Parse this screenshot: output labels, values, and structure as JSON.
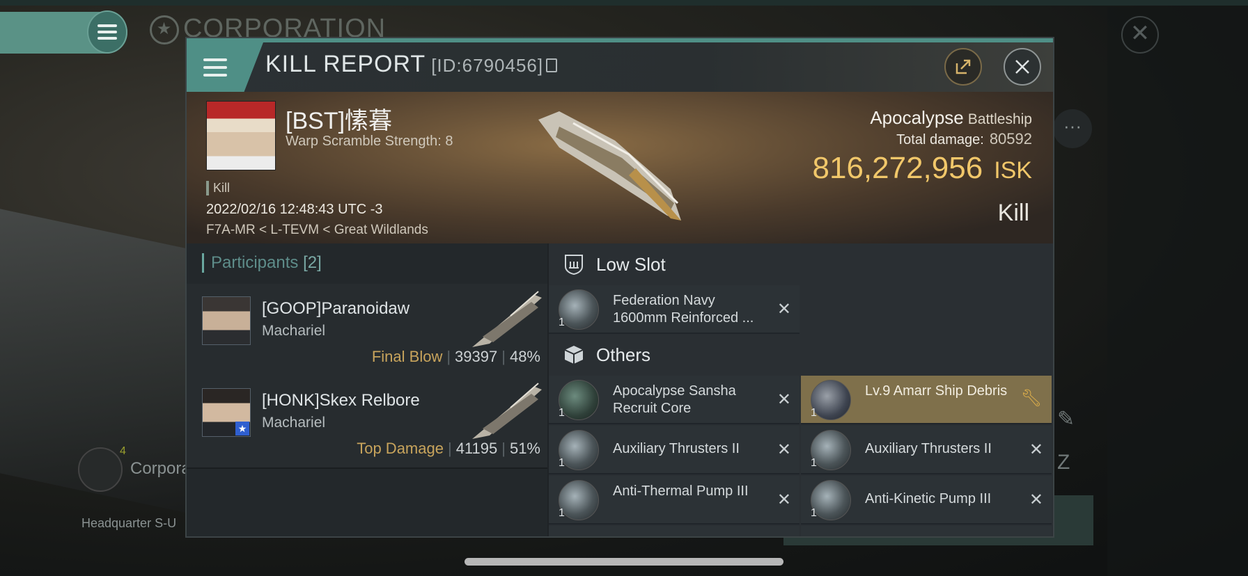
{
  "background": {
    "corp_title": "CORPORATION",
    "corp_label": "Corpora",
    "corp_number": "4",
    "headquarter": "Headquarter S-U"
  },
  "dialog": {
    "title": "KILL REPORT",
    "id": "[ID:6790456]"
  },
  "banner": {
    "pilot": "[BST]愫暮",
    "warp_scramble": "Warp Scramble Strength: 8",
    "kill_tag": "Kill",
    "datetime": "2022/02/16 12:48:43 UTC -3",
    "location": "F7A-MR < L-TEVM < Great Wildlands",
    "ship_name": "Apocalypse",
    "ship_class": "Battleship",
    "total_damage_label": "Total damage:",
    "total_damage": "80592",
    "isk_value": "816,272,956",
    "isk_unit": "ISK",
    "result": "Kill"
  },
  "participants": {
    "title": "Participants",
    "count": "[2]",
    "rows": [
      {
        "name": "[GOOP]Paranoidaw",
        "ship": "Machariel",
        "role": "Final Blow",
        "damage": "39397",
        "percent": "48%"
      },
      {
        "name": "[HONK]Skex Relbore",
        "ship": "Machariel",
        "role": "Top Damage",
        "damage": "41195",
        "percent": "51%"
      }
    ]
  },
  "low_slot": {
    "title": "Low Slot",
    "items": [
      {
        "qty": "1",
        "name": "Federation Navy 1600mm Reinforced ..."
      }
    ]
  },
  "others": {
    "title": "Others",
    "items": [
      {
        "qty": "1",
        "name": "Apocalypse Sansha Recruit Core"
      },
      {
        "qty": "1",
        "name": "Lv.9 Amarr Ship Debris"
      },
      {
        "qty": "1",
        "name": "Auxiliary Thrusters II"
      },
      {
        "qty": "1",
        "name": "Auxiliary Thrusters II"
      },
      {
        "qty": "1",
        "name": "Anti-Thermal Pump III"
      },
      {
        "qty": "1",
        "name": "Anti-Kinetic Pump III"
      }
    ]
  },
  "colors": {
    "accent": "#4f8f86",
    "isk": "#f1c76a",
    "highlight": "#7f704b"
  }
}
